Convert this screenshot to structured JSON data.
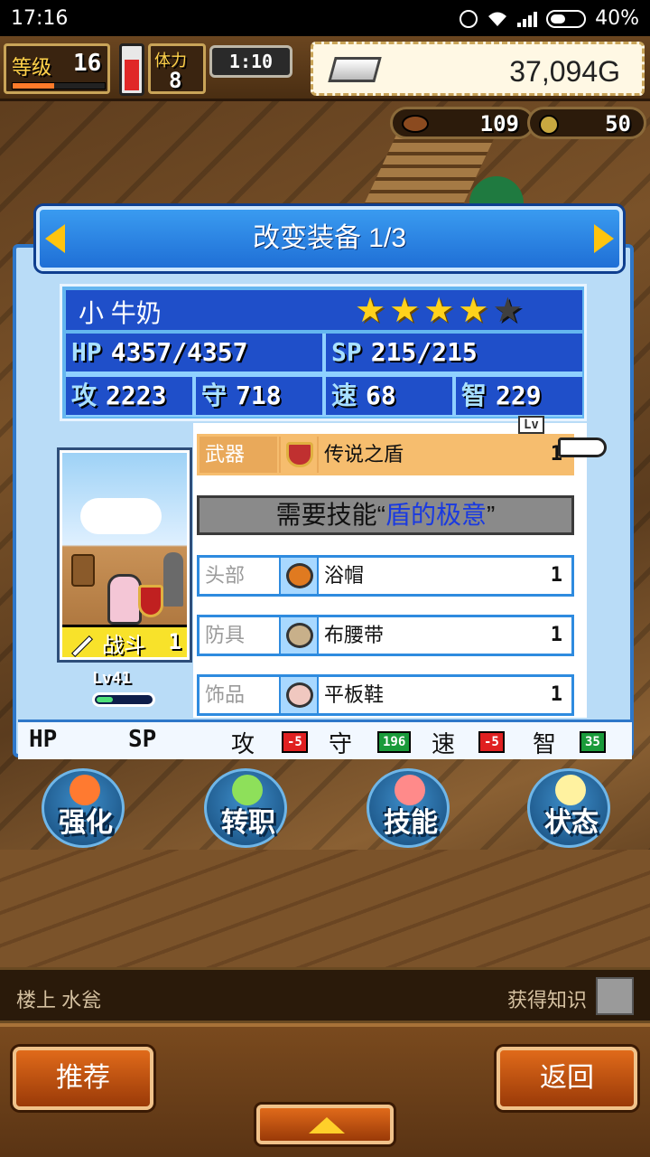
{
  "status_bar": {
    "time": "17:16",
    "battery": "40%"
  },
  "hud": {
    "level_label": "等级",
    "level": "16",
    "level_progress": 0.45,
    "hp_fill": 0.75,
    "stamina_label": "体力",
    "stamina": "8",
    "timer": "1:10",
    "gold": "37,094G",
    "counter_1": "109",
    "counter_2": "50"
  },
  "dialog": {
    "title": "改变装备 1/3",
    "character": {
      "name": "小 牛奶",
      "stars": 4,
      "max_stars": 5,
      "hp_label": "HP",
      "hp": "4357/4357",
      "sp_label": "SP",
      "sp": "215/215",
      "atk_label": "攻",
      "atk": "2223",
      "def_label": "守",
      "def": "718",
      "spd_label": "速",
      "spd": "68",
      "int_label": "智",
      "int": "229",
      "battle_label": "战斗",
      "battle_value": "1",
      "lv_label": "Lv41",
      "lv_progress": 0.3
    },
    "lv_header": "Lv",
    "weapon": {
      "slot": "武器",
      "name": "传说之盾",
      "level": "1",
      "icon": "shield-icon"
    },
    "requirement": {
      "prefix": "需要技能“",
      "skill": "盾的极意",
      "suffix": "”"
    },
    "equipment": [
      {
        "slot": "头部",
        "name": "浴帽",
        "level": "1",
        "icon": "donut-icon",
        "color": "#e07a20"
      },
      {
        "slot": "防具",
        "name": "布腰带",
        "level": "1",
        "icon": "belt-icon",
        "color": "#c8b08a"
      },
      {
        "slot": "饰品",
        "name": "平板鞋",
        "level": "1",
        "icon": "shoe-icon",
        "color": "#f0c8c0"
      }
    ],
    "diff": {
      "hp": "HP",
      "sp": "SP",
      "atk": "攻",
      "atk_delta": "-5",
      "def": "守",
      "def_delta": "196",
      "spd": "速",
      "spd_delta": "-5",
      "int": "智",
      "int_delta": "35"
    }
  },
  "actions": [
    {
      "label": "强化",
      "icon": "up-arrow-icon",
      "color": "#ff7a30"
    },
    {
      "label": "转职",
      "icon": "gem-icon",
      "color": "#8ee05a"
    },
    {
      "label": "技能",
      "icon": "flame-icon",
      "color": "#ff8a8a"
    },
    {
      "label": "状态",
      "icon": "sparkle-icon",
      "color": "#fff2a0"
    }
  ],
  "info_bar": {
    "location": "楼上 水瓮",
    "knowledge": "获得知识"
  },
  "bottom": {
    "recommend": "推荐",
    "back": "返回"
  }
}
